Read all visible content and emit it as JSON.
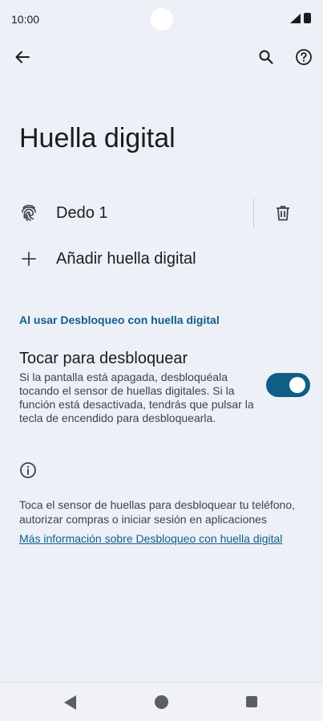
{
  "status_bar": {
    "time": "10:00"
  },
  "header": {
    "title": "Huella digital"
  },
  "fingerprints": [
    {
      "label": "Dedo 1"
    }
  ],
  "add_fingerprint": {
    "label": "Añadir huella digital"
  },
  "section": {
    "title": "Al usar Desbloqueo con huella digital"
  },
  "touch_unlock": {
    "title": "Tocar para desbloquear",
    "description": "Si la pantalla está apagada, desbloquéala tocando el sensor de huellas digitales. Si la función está desactivada, tendrás que pulsar la tecla de encendido para desbloquearla.",
    "enabled": true
  },
  "info": {
    "text": "Toca el sensor de huellas para desbloquear tu teléfono, autorizar compras o iniciar sesión en aplicaciones",
    "link": "Más información sobre Desbloqueo con huella digital"
  },
  "colors": {
    "accent": "#0f5f8a",
    "switch_on": "#0e5e86",
    "background": "#eef0f8"
  },
  "icons": {
    "back": "arrow-left-icon",
    "search": "search-icon",
    "help": "help-circle-icon",
    "fingerprint": "fingerprint-icon",
    "delete": "trash-icon",
    "add": "plus-icon",
    "info": "info-icon"
  }
}
